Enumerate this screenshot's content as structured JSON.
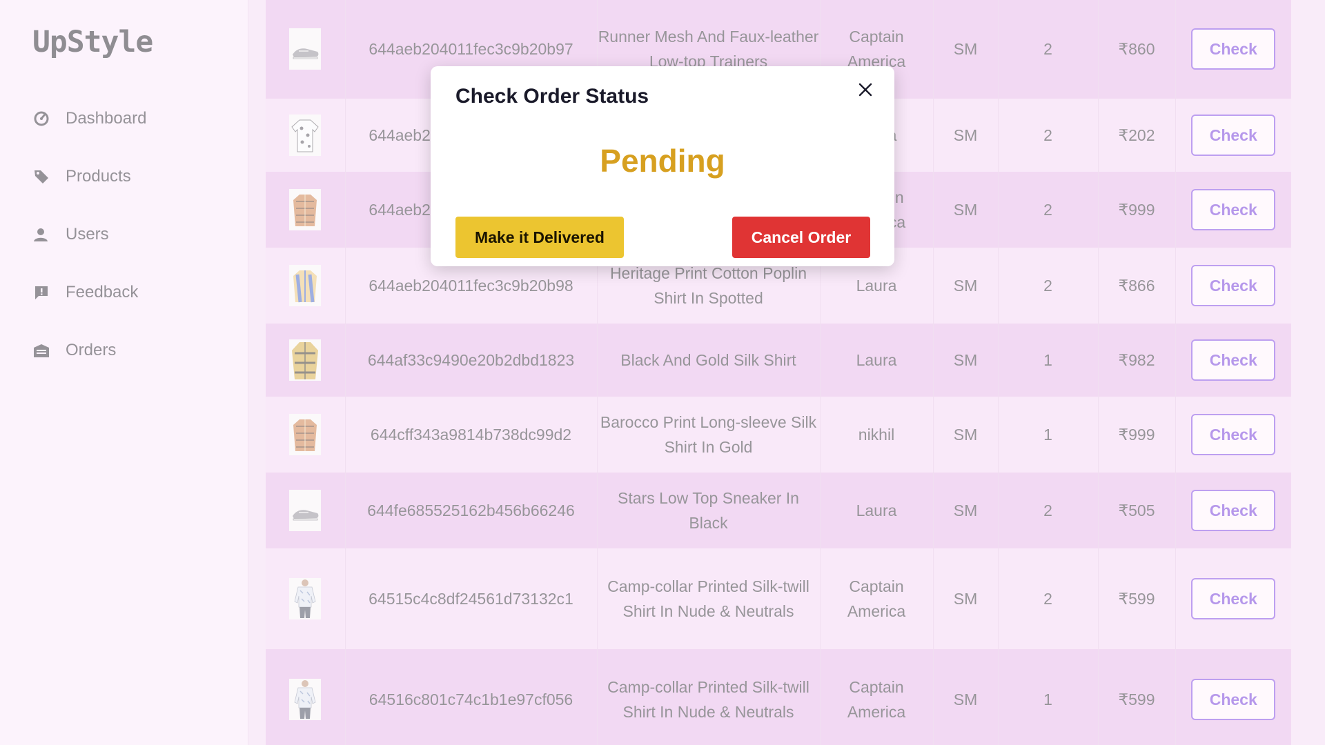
{
  "brand": "UpStyle",
  "sidebar": {
    "items": [
      {
        "label": "Dashboard",
        "icon": "dashboard-gauge-icon"
      },
      {
        "label": "Products",
        "icon": "tag-icon"
      },
      {
        "label": "Users",
        "icon": "user-icon"
      },
      {
        "label": "Feedback",
        "icon": "feedback-icon"
      },
      {
        "label": "Orders",
        "icon": "inbox-icon"
      }
    ]
  },
  "orders": {
    "rows": [
      {
        "id": "644aeb204011fec3c9b20b97",
        "product": "Runner Mesh And Faux-leather Low-top Trainers",
        "user": "Captain America",
        "size": "SM",
        "qty": "2",
        "price": "₹860",
        "action": "Check",
        "thumb": "sneaker"
      },
      {
        "id": "644aeb204011fec3c9b20b95",
        "product": "",
        "user": "Laura",
        "size": "SM",
        "qty": "2",
        "price": "₹202",
        "action": "Check",
        "thumb": "white-print-shirt"
      },
      {
        "id": "644aeb204011fec3c9b20b96",
        "product": "",
        "user": "Captain America",
        "size": "SM",
        "qty": "2",
        "price": "₹999",
        "action": "Check",
        "thumb": "orange-print-shirt"
      },
      {
        "id": "644aeb204011fec3c9b20b98",
        "product": "Heritage Print Cotton Poplin Shirt In Spotted",
        "user": "Laura",
        "size": "SM",
        "qty": "2",
        "price": "₹866",
        "action": "Check",
        "thumb": "blue-print-shirt"
      },
      {
        "id": "644af33c9490e20b2dbd1823",
        "product": "Black And Gold Silk Shirt",
        "user": "Laura",
        "size": "SM",
        "qty": "1",
        "price": "₹982",
        "action": "Check",
        "thumb": "gold-shirt"
      },
      {
        "id": "644cff343a9814b738dc99d2",
        "product": "Barocco Print Long-sleeve Silk Shirt In Gold",
        "user": "nikhil",
        "size": "SM",
        "qty": "1",
        "price": "₹999",
        "action": "Check",
        "thumb": "orange-print-shirt"
      },
      {
        "id": "644fe685525162b456b66246",
        "product": "Stars Low Top Sneaker In Black",
        "user": "Laura",
        "size": "SM",
        "qty": "2",
        "price": "₹505",
        "action": "Check",
        "thumb": "sneaker"
      },
      {
        "id": "64515c4c8df24561d73132c1",
        "product": "Camp-collar Printed Silk-twill Shirt In Nude & Neutrals",
        "user": "Captain America",
        "size": "SM",
        "qty": "2",
        "price": "₹599",
        "action": "Check",
        "thumb": "model-shirt"
      },
      {
        "id": "64516c801c74c1b1e97cf056",
        "product": "Camp-collar Printed Silk-twill Shirt In Nude & Neutrals",
        "user": "Captain America",
        "size": "SM",
        "qty": "1",
        "price": "₹599",
        "action": "Check",
        "thumb": "model-shirt"
      }
    ]
  },
  "modal": {
    "title": "Check Order Status",
    "status": "Pending",
    "status_color": "#d7a020",
    "deliver_label": "Make it Delivered",
    "cancel_label": "Cancel Order",
    "close_icon": "close-icon"
  },
  "colors": {
    "row_odd": "#e4b3e6",
    "row_even": "#f2d2f2",
    "check_accent": "#7b3fe0",
    "deliver_button": "#ecc530",
    "cancel_button": "#e03434"
  }
}
